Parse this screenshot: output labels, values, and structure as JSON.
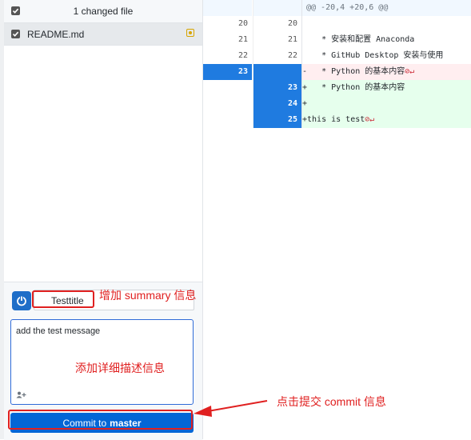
{
  "changes": {
    "header_label": "1 changed file",
    "files": [
      {
        "name": "README.md",
        "status": "modified"
      }
    ]
  },
  "diff": {
    "rows": [
      {
        "type": "hunk",
        "old": "",
        "new": "",
        "text": "@@ -20,4 +20,6 @@"
      },
      {
        "type": "ctx",
        "old": "20",
        "new": "20",
        "text": ""
      },
      {
        "type": "ctx",
        "old": "21",
        "new": "21",
        "text": "    * 安装和配置 Anaconda"
      },
      {
        "type": "ctx",
        "old": "22",
        "new": "22",
        "text": "    * GitHub Desktop 安装与使用"
      },
      {
        "type": "del",
        "old": "23",
        "new": "",
        "text": "-   * Python 的基本内容",
        "marker": "⊘↵"
      },
      {
        "type": "add",
        "old": "",
        "new": "23",
        "text": "+   * Python 的基本内容"
      },
      {
        "type": "add",
        "old": "",
        "new": "24",
        "text": "+"
      },
      {
        "type": "add",
        "old": "",
        "new": "25",
        "text": "+this is test",
        "marker": "⊘↵"
      }
    ]
  },
  "commit": {
    "summary_value": "Testtitle",
    "description_value": "add the test message",
    "button_prefix": "Commit to",
    "branch": "master"
  },
  "annotations": {
    "summary_note": "增加 summary 信息",
    "description_note": "添加详细描述信息",
    "commit_note": "点击提交 commit 信息"
  },
  "colors": {
    "accent": "#0366d6",
    "annotation": "#e02020",
    "deleted_bg": "#ffeef0",
    "added_bg": "#e6ffed"
  }
}
